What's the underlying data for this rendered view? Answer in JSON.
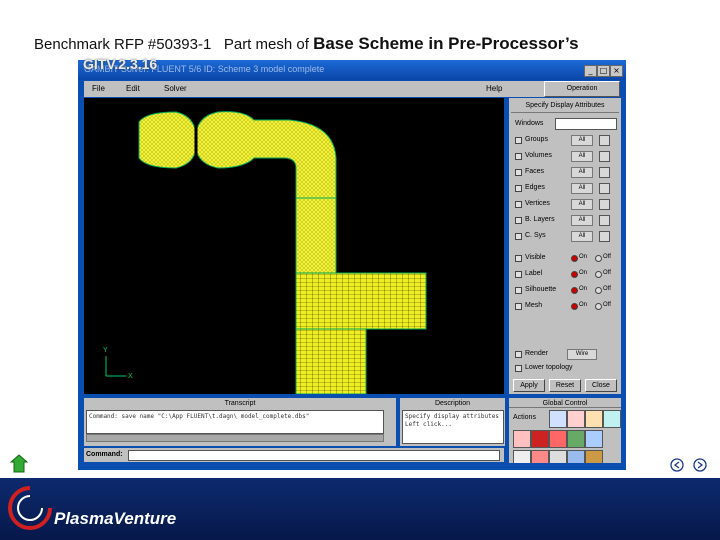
{
  "slide": {
    "title_left": "Benchmark RFP #50393-1",
    "title_mid": "Part mesh of",
    "title_bold": "Base Scheme in Pre-Processor’s",
    "subtitle": "GITV.2.3.16"
  },
  "app": {
    "window_title": "GAMBIT   Solver: FLUENT 5/6   ID: Scheme 3 model complete",
    "menu": [
      "File",
      "Edit",
      "Solver"
    ],
    "help": "Help",
    "operation": "Operation",
    "axes": {
      "y": "Y",
      "x": "X"
    },
    "panel": {
      "title": "Specify Display Attributes",
      "windows_label": "Windows",
      "entities": [
        {
          "label": "Groups",
          "value": "All"
        },
        {
          "label": "Volumes",
          "value": "All"
        },
        {
          "label": "Faces",
          "value": "All"
        },
        {
          "label": "Edges",
          "value": "All"
        },
        {
          "label": "Vertices",
          "value": "All"
        },
        {
          "label": "B. Layers",
          "value": "All"
        },
        {
          "label": "C. Sys",
          "value": "All"
        }
      ],
      "toggles": [
        {
          "label": "Visible",
          "on": "On",
          "off": "Off"
        },
        {
          "label": "Label",
          "on": "On",
          "off": "Off"
        },
        {
          "label": "Silhouette",
          "on": "On",
          "off": "Off"
        },
        {
          "label": "Mesh",
          "on": "On",
          "off": "Off"
        }
      ],
      "render_label": "Render",
      "render_value": "Wire",
      "lower_label": "Lower topology",
      "apply": "Apply",
      "reset": "Reset",
      "close": "Close"
    },
    "global_control": "Global Control",
    "actions": "Actions",
    "transcript": {
      "header": "Transcript",
      "line": "Command: save name \"C:\\App FLUENT\\t.dagn\\ model_complete.dbs\""
    },
    "description": {
      "header": "Description",
      "line1": "Specify display attributes",
      "line2": "Left click..."
    },
    "command_label": "Command:"
  },
  "footer": {
    "brand": "PlasmaVenture"
  },
  "colors": {
    "mesh": "#ffff33",
    "edge": "#00cc66",
    "footer_bg": "#0d2a6e",
    "window_blue": "#0a4fb0"
  }
}
